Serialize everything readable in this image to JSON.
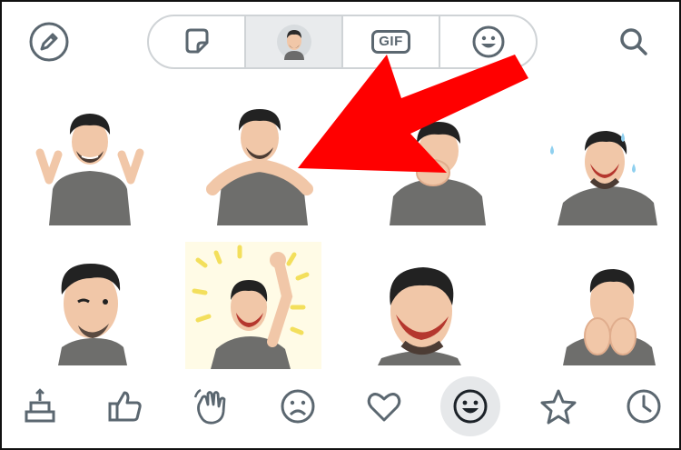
{
  "app": {
    "picker": "sticker-avatar-picker",
    "accent_color": "#5b6770",
    "active_tab": "avatar",
    "active_category": "smileys"
  },
  "header": {
    "left_icon": "pencil-icon",
    "right_icon": "search-icon",
    "tabs": [
      {
        "id": "stickers",
        "icon": "sticker-icon"
      },
      {
        "id": "avatar",
        "icon": "avatar-icon"
      },
      {
        "id": "gif",
        "icon": "gif-icon",
        "label": "GIF"
      },
      {
        "id": "emoji",
        "icon": "smiley-icon"
      }
    ]
  },
  "stickers": [
    {
      "name": "peace-sign-avatar"
    },
    {
      "name": "chin-on-hands-avatar"
    },
    {
      "name": "hands-over-mouth-avatar"
    },
    {
      "name": "sweating-laugh-avatar"
    },
    {
      "name": "winking-avatar"
    },
    {
      "name": "celebrating-fist-avatar"
    },
    {
      "name": "laughing-avatar"
    },
    {
      "name": "giggling-avatar"
    }
  ],
  "categories": [
    {
      "id": "celebrate",
      "icon": "cake-icon"
    },
    {
      "id": "thumbs-up",
      "icon": "thumbs-up-icon"
    },
    {
      "id": "wave",
      "icon": "waving-hand-icon"
    },
    {
      "id": "sad",
      "icon": "sad-face-icon"
    },
    {
      "id": "love",
      "icon": "heart-icon"
    },
    {
      "id": "smileys",
      "icon": "smiley-icon"
    },
    {
      "id": "favorites",
      "icon": "star-icon"
    },
    {
      "id": "recent",
      "icon": "clock-icon"
    }
  ],
  "annotation": {
    "type": "arrow",
    "color": "#ff0000",
    "points_to": "avatar-tab"
  }
}
